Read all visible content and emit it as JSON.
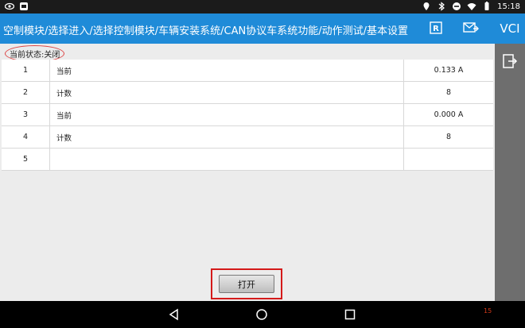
{
  "status_bar": {
    "time": "15:18"
  },
  "header": {
    "breadcrumb": "空制模块/选择进入/选择控制模块/车辆安装系统/CAN协议车系统功能/动作测试/基本设置"
  },
  "side_panel": {
    "vci_label": "VCI"
  },
  "current_status": "当前状态:关闭",
  "table": {
    "rows": [
      {
        "index": "1",
        "name": "当前",
        "value": "0.133 A"
      },
      {
        "index": "2",
        "name": "计数",
        "value": "8"
      },
      {
        "index": "3",
        "name": "当前",
        "value": "0.000 A"
      },
      {
        "index": "4",
        "name": "计数",
        "value": "8"
      },
      {
        "index": "5",
        "name": "",
        "value": ""
      }
    ]
  },
  "open_button_label": "打开",
  "nav_bar": {
    "corner_number": "15"
  },
  "colors": {
    "header": "#1f8bd8",
    "side_panel": "#6e6e6e",
    "highlight": "#d41a1a"
  }
}
